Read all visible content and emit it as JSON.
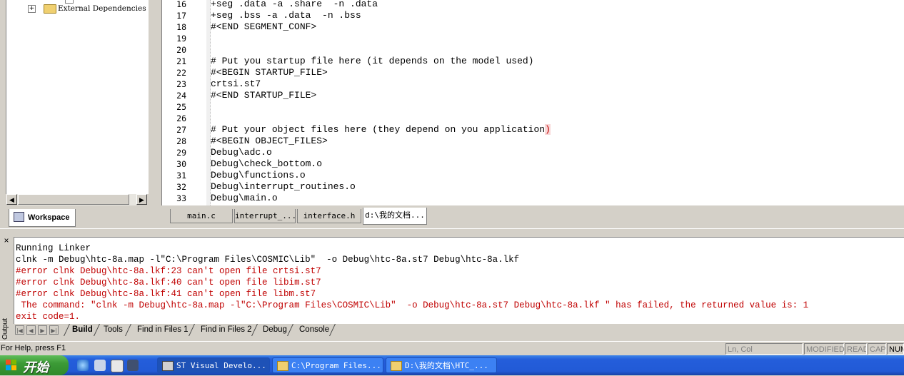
{
  "workspace": {
    "tree_item": "External Dependencies",
    "tab_label": "Workspace"
  },
  "editor": {
    "lines": [
      {
        "num": "16",
        "text": "+seg .data -a .share  -n .data"
      },
      {
        "num": "17",
        "text": "+seg .bss -a .data  -n .bss"
      },
      {
        "num": "18",
        "text": "#<END SEGMENT_CONF>"
      },
      {
        "num": "19",
        "text": ""
      },
      {
        "num": "20",
        "text": ""
      },
      {
        "num": "21",
        "text": "# Put you startup file here (it depends on the model used)"
      },
      {
        "num": "22",
        "text": "#<BEGIN STARTUP_FILE>"
      },
      {
        "num": "23",
        "text": "crtsi.st7"
      },
      {
        "num": "24",
        "text": "#<END STARTUP_FILE>"
      },
      {
        "num": "25",
        "text": ""
      },
      {
        "num": "26",
        "text": ""
      },
      {
        "num": "27",
        "text": "# Put your object files here (they depend on you application",
        "tail": ")"
      },
      {
        "num": "28",
        "text": "#<BEGIN OBJECT_FILES>"
      },
      {
        "num": "29",
        "text": "Debug\\adc.o"
      },
      {
        "num": "30",
        "text": "Debug\\check_bottom.o"
      },
      {
        "num": "31",
        "text": "Debug\\functions.o"
      },
      {
        "num": "32",
        "text": "Debug\\interrupt_routines.o"
      },
      {
        "num": "33",
        "text": "Debug\\main.o"
      }
    ],
    "tabs": [
      "main.c",
      "interrupt_...",
      "interface.h",
      "d:\\我的文档..."
    ]
  },
  "output": {
    "close_glyph": "×",
    "side_label": "Output",
    "lines": [
      {
        "text": "Running Linker",
        "error": false
      },
      {
        "text": "clnk -m Debug\\htc-8a.map -l\"C:\\Program Files\\COSMIC\\Lib\"  -o Debug\\htc-8a.st7 Debug\\htc-8a.lkf",
        "error": false
      },
      {
        "text": "#error clnk Debug\\htc-8a.lkf:23 can't open file crtsi.st7",
        "error": true
      },
      {
        "text": "#error clnk Debug\\htc-8a.lkf:40 can't open file libim.st7",
        "error": true
      },
      {
        "text": "#error clnk Debug\\htc-8a.lkf:41 can't open file libm.st7",
        "error": true
      },
      {
        "text": " The command: \"clnk -m Debug\\htc-8a.map -l\"C:\\Program Files\\COSMIC\\Lib\"  -o Debug\\htc-8a.st7 Debug\\htc-8a.lkf \" has failed, the returned value is: 1",
        "error": true
      },
      {
        "text": "exit code=1.",
        "error": true
      }
    ],
    "tabs": [
      "Build",
      "Tools",
      "Find in Files 1",
      "Find in Files 2",
      "Debug",
      "Console"
    ],
    "active_tab": "Build"
  },
  "statusbar": {
    "help": "For Help, press F1",
    "position": "Ln, Col",
    "modified": "MODIFIED",
    "read": "READ",
    "cap": "CAP",
    "num": "NUM"
  },
  "taskbar": {
    "start_label": "开始",
    "tasks": [
      "ST Visual Develo...",
      "C:\\Program Files...",
      "D:\\我的文档\\HTC_..."
    ]
  },
  "colors": {
    "error_text": "#c00000",
    "taskbar_blue": "#245edb",
    "start_green": "#3c9a36"
  }
}
